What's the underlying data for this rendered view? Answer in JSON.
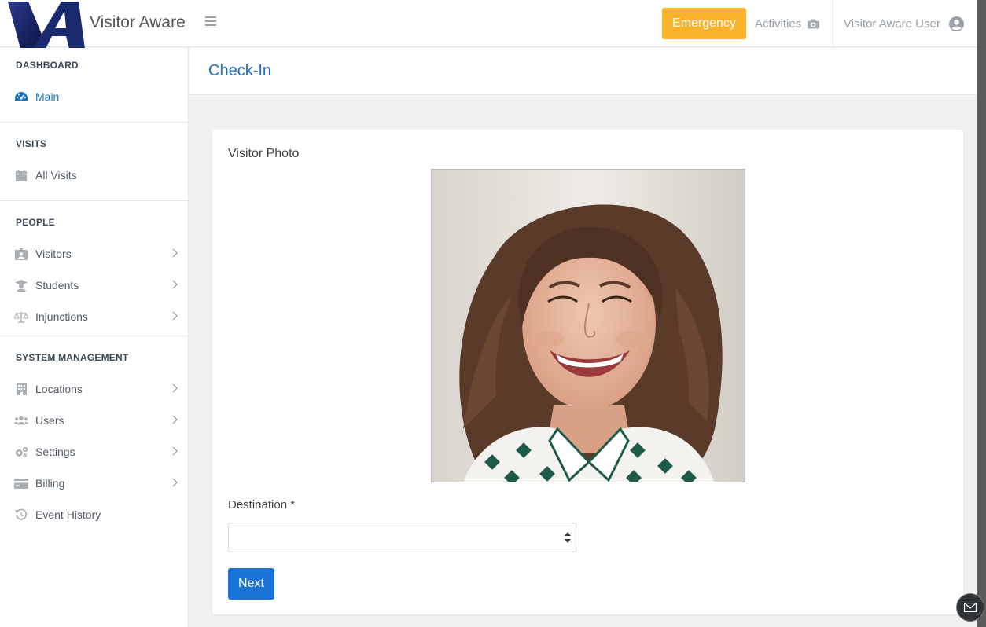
{
  "app": {
    "name": "Visitor Aware"
  },
  "topbar": {
    "emergency_label": "Emergency",
    "activities_label": "Activities",
    "user_label": "Visitor Aware User"
  },
  "sidebar": {
    "sections": [
      {
        "title": "DASHBOARD",
        "items": [
          {
            "label": "Main",
            "icon": "dashboard-icon",
            "active": true
          }
        ]
      },
      {
        "title": "VISITS",
        "items": [
          {
            "label": "All Visits",
            "icon": "calendar-icon"
          }
        ]
      },
      {
        "title": "PEOPLE",
        "items": [
          {
            "label": "Visitors",
            "icon": "id-badge-icon"
          },
          {
            "label": "Students",
            "icon": "graduation-cap-icon"
          },
          {
            "label": "Injunctions",
            "icon": "balance-scale-icon"
          }
        ]
      },
      {
        "title": "SYSTEM MANAGEMENT",
        "items": [
          {
            "label": "Locations",
            "icon": "building-icon"
          },
          {
            "label": "Users",
            "icon": "users-icon"
          },
          {
            "label": "Settings",
            "icon": "gears-icon"
          },
          {
            "label": "Billing",
            "icon": "credit-card-icon"
          },
          {
            "label": "Event History",
            "icon": "history-icon"
          }
        ]
      }
    ]
  },
  "page": {
    "title": "Check-In",
    "photo_label": "Visitor Photo",
    "destination_label": "Destination *",
    "destination_value": "",
    "next_label": "Next"
  },
  "colors": {
    "accent": "#1a73d6",
    "emergency": "#f9b32a",
    "title": "#1f6fc0"
  }
}
